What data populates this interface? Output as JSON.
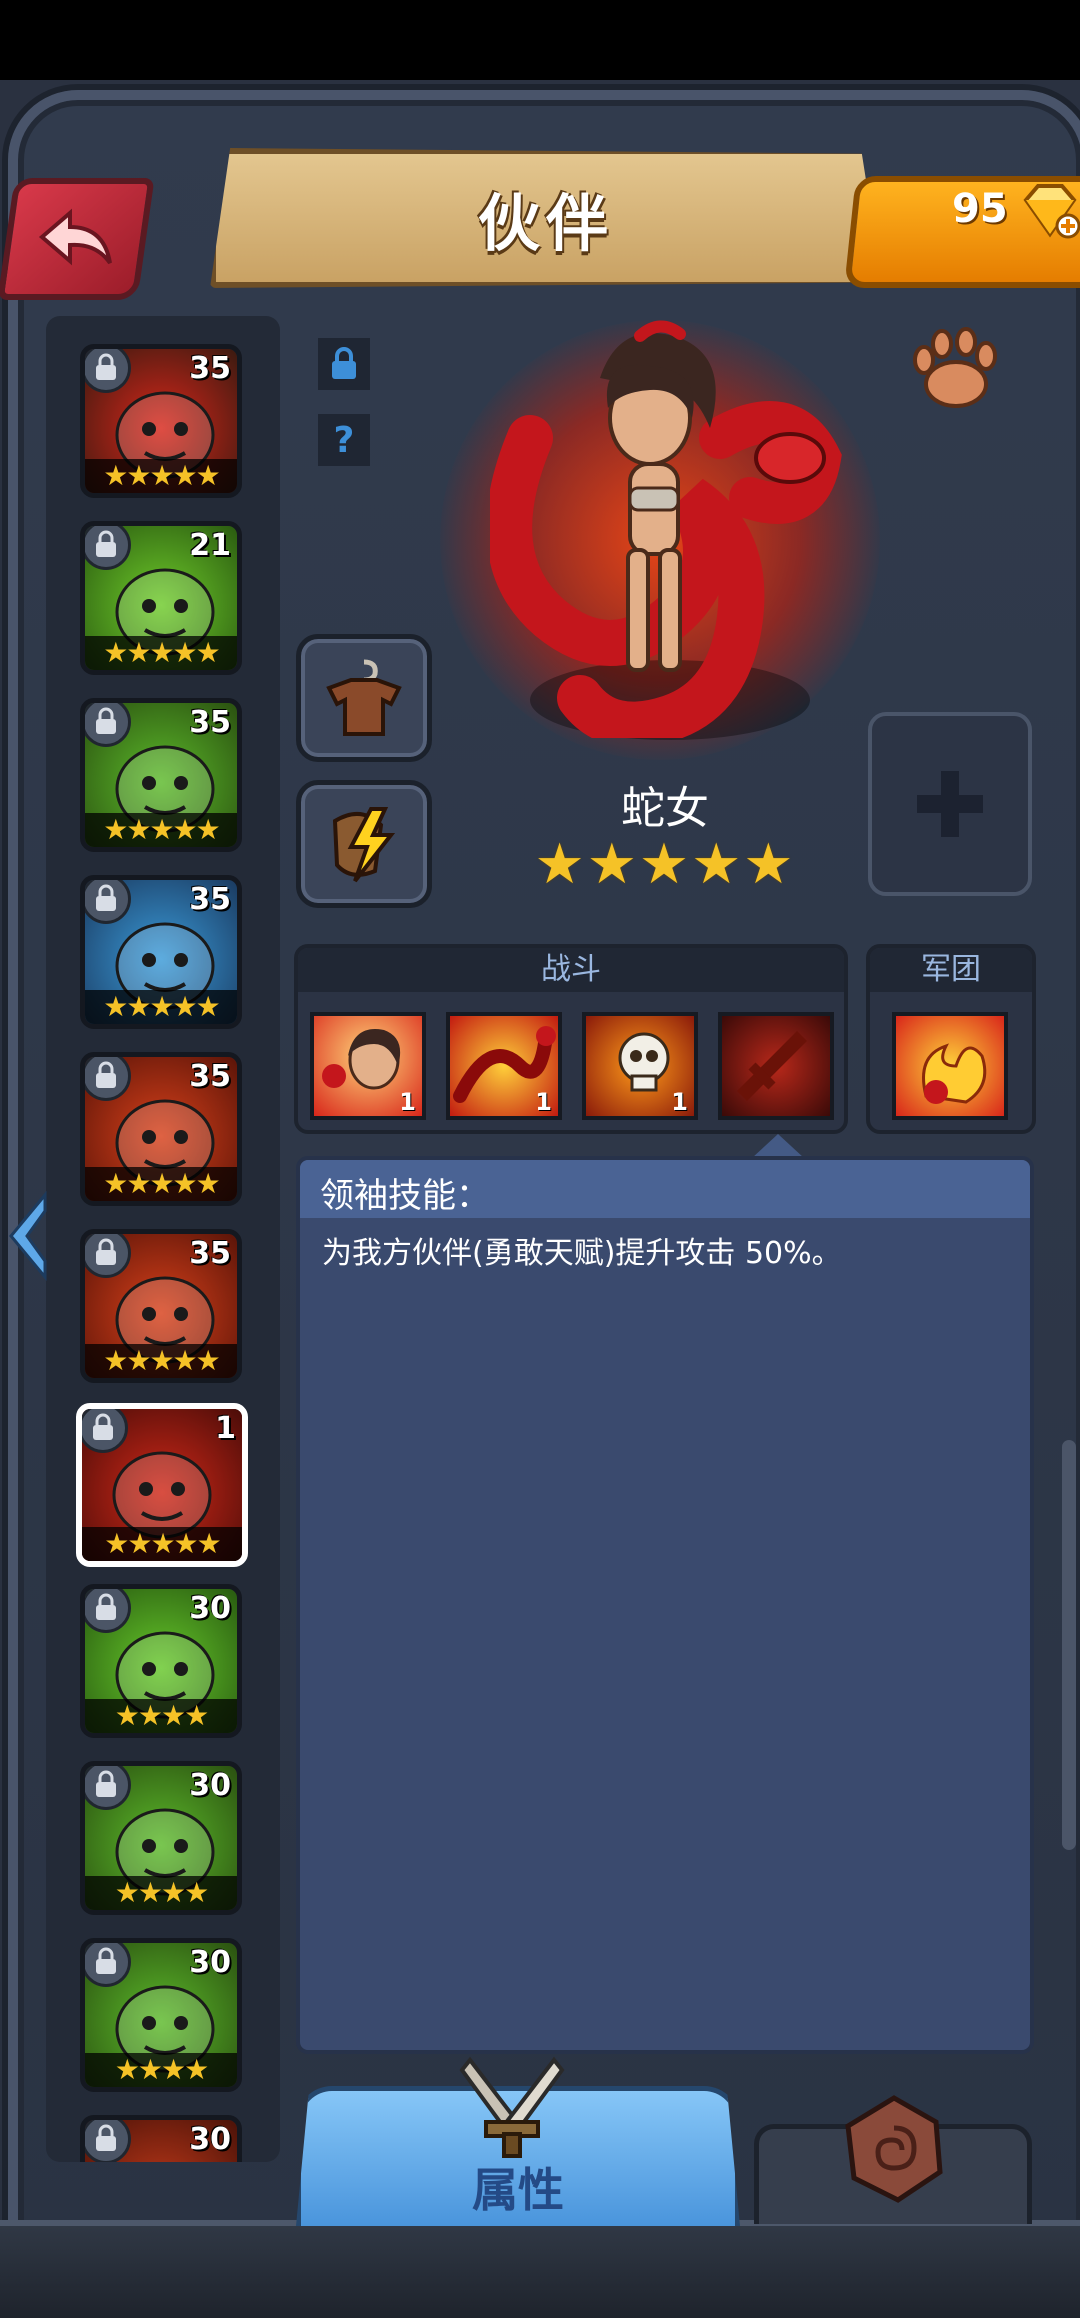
{
  "header": {
    "title": "伙伴",
    "gems": "95"
  },
  "heroes": [
    {
      "level": "35",
      "stars": "★★★★★",
      "locked": true
    },
    {
      "level": "21",
      "stars": "★★★★★",
      "locked": true
    },
    {
      "level": "35",
      "stars": "★★★★★",
      "locked": true
    },
    {
      "level": "35",
      "stars": "★★★★★",
      "locked": true
    },
    {
      "level": "35",
      "stars": "★★★★★",
      "locked": true
    },
    {
      "level": "35",
      "stars": "★★★★★",
      "locked": true
    },
    {
      "level": "1",
      "stars": "★★★★★",
      "locked": true,
      "selected": true
    },
    {
      "level": "30",
      "stars": "★★★★",
      "locked": false
    },
    {
      "level": "30",
      "stars": "★★★★",
      "locked": true
    },
    {
      "level": "30",
      "stars": "★★★★",
      "locked": true
    },
    {
      "level": "30",
      "stars": "",
      "locked": true
    }
  ],
  "selected_hero": {
    "name": "蛇女",
    "stars": "★★★★★"
  },
  "skills": {
    "battle_label": "战斗",
    "legion_label": "军团",
    "battle_levels": [
      "1",
      "1",
      "1",
      ""
    ]
  },
  "description": {
    "title": "领袖技能：",
    "body": "为我方伙伴(勇敢天赋)提升攻击 50%。"
  },
  "tabs": {
    "attributes_label": "属性"
  },
  "colors": {
    "background": "#2a3140",
    "accent_gold": "#f5c227",
    "tab_blue": "#4a95dc",
    "back_red": "#d8394a"
  }
}
